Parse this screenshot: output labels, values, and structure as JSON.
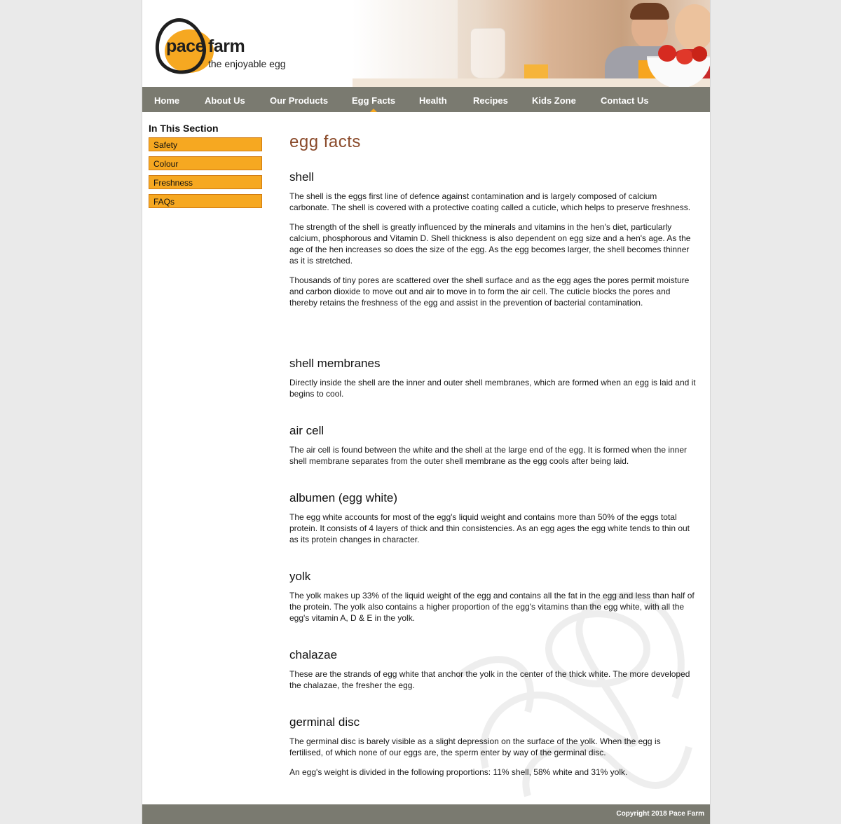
{
  "brand": {
    "name_part1": "pace",
    "name_part2": "farm",
    "tagline": "the enjoyable egg",
    "accent_color": "#f6a821",
    "nav_color": "#7a7a70",
    "heading_color": "#8a4a2a"
  },
  "nav": {
    "items": [
      {
        "label": "Home"
      },
      {
        "label": "About Us"
      },
      {
        "label": "Our Products"
      },
      {
        "label": "Egg Facts",
        "active": true
      },
      {
        "label": "Health"
      },
      {
        "label": "Recipes"
      },
      {
        "label": "Kids Zone"
      },
      {
        "label": "Contact Us"
      }
    ]
  },
  "sidebar": {
    "title": "In This Section",
    "items": [
      {
        "label": "Safety"
      },
      {
        "label": "Colour"
      },
      {
        "label": "Freshness"
      },
      {
        "label": "FAQs"
      }
    ]
  },
  "main": {
    "title": "egg facts",
    "sections": [
      {
        "heading": "shell",
        "paragraphs": [
          "The shell is the eggs first line of defence against contamination and is largely composed of calcium carbonate. The shell is covered with a protective coating called a cuticle, which helps to preserve freshness.",
          "The strength of the shell is greatly influenced by the minerals and vitamins in the hen's diet, particularly calcium, phosphorous and Vitamin D. Shell thickness is also dependent on egg size and a hen's age. As the age of the hen increases so does the size of the egg. As the egg becomes larger, the shell becomes thinner as it is stretched.",
          "Thousands of tiny pores are scattered over the shell surface and as the egg ages the pores permit moisture and carbon dioxide to move out and air to move in to form the air cell. The cuticle blocks the pores and thereby retains the freshness of the egg and assist in the prevention of bacterial contamination."
        ]
      },
      {
        "heading": "shell membranes",
        "paragraphs": [
          "Directly inside the shell are the inner and outer shell membranes, which are formed when an egg is laid and it begins to cool."
        ]
      },
      {
        "heading": "air cell",
        "paragraphs": [
          "The air cell is found between the white and the shell at the large end of the egg. It is formed when the inner shell membrane separates from the outer shell membrane as the egg cools after being laid."
        ]
      },
      {
        "heading": "albumen (egg white)",
        "paragraphs": [
          "The egg white accounts for most of the egg's liquid weight and contains more than 50% of the eggs total protein. It consists of 4 layers of thick and thin consistencies. As an egg ages the egg white tends to thin out as its protein changes in character."
        ]
      },
      {
        "heading": "yolk",
        "paragraphs": [
          "The yolk makes up 33% of the liquid weight of the egg and contains all the fat in the egg and less than half of the protein. The yolk also contains a higher proportion of the egg's vitamins than the egg white, with all the egg's vitamin A, D & E in the yolk."
        ]
      },
      {
        "heading": "chalazae",
        "paragraphs": [
          "These are the strands of egg white that anchor the yolk in the center of the thick white. The more developed the chalazae, the fresher the egg."
        ]
      },
      {
        "heading": "germinal disc",
        "paragraphs": [
          "The germinal disc is barely visible as a slight depression on the surface of the yolk. When the egg is fertilised, of which none of our eggs are, the sperm enter by way of the germinal disc.",
          "An egg's weight is divided in the following proportions: 11% shell, 58% white and 31% yolk."
        ]
      }
    ]
  },
  "footer": {
    "copyright": "Copyright 2018 Pace Farm"
  }
}
